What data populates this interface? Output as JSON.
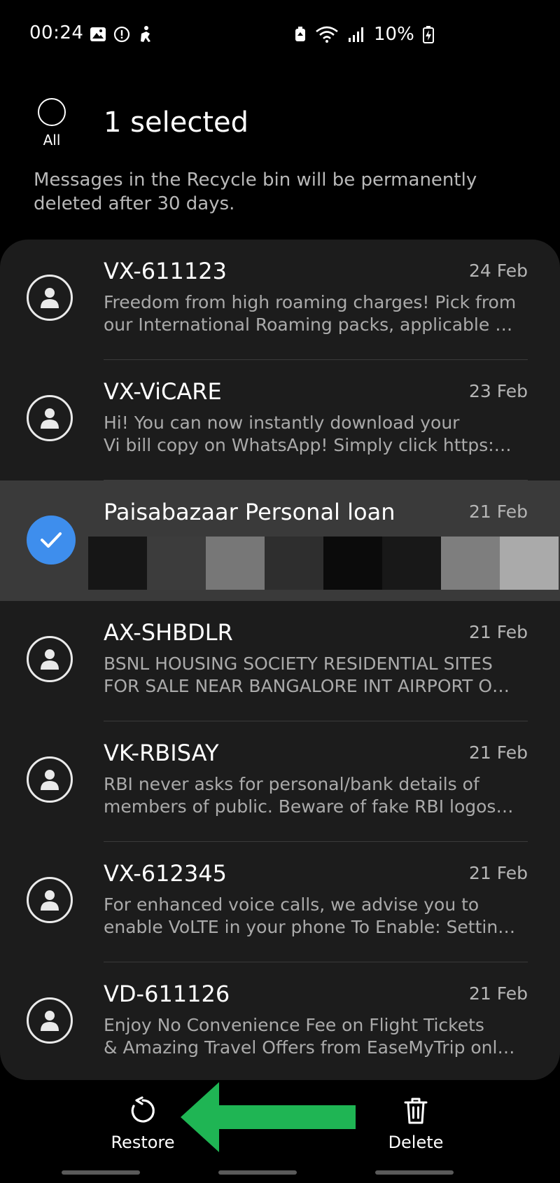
{
  "status_bar": {
    "time": "00:24",
    "battery": "10%",
    "icons_left": [
      "image-icon",
      "alert-icon",
      "accessibility-icon"
    ],
    "icons_right": [
      "battery-saver-icon",
      "wifi-icon",
      "signal-icon",
      "battery-charging-icon"
    ]
  },
  "header": {
    "select_all_label": "All",
    "title": "1 selected"
  },
  "notice": "Messages in the Recycle bin will be permanently deleted after 30 days.",
  "messages": [
    {
      "sender": "VX-611123",
      "date": "24 Feb",
      "line1": "Freedom from high roaming charges! Pick from",
      "line2": "our International Roaming packs, applicable in...",
      "selected": false
    },
    {
      "sender": "VX-ViCARE",
      "date": "23 Feb",
      "line1": "Hi! You can now instantly download your",
      "line2": "Vi bill copy on WhatsApp! Simply click https://...",
      "selected": false
    },
    {
      "sender": "Paisabazaar Personal loan",
      "date": "21 Feb",
      "line1": "",
      "line2": "",
      "selected": true
    },
    {
      "sender": "AX-SHBDLR",
      "date": "21 Feb",
      "line1": "BSNL HOUSING SOCIETY RESIDENTIAL SITES",
      "line2": "FOR SALE NEAR BANGALORE INT AIRPORT ON...",
      "selected": false
    },
    {
      "sender": "VK-RBISAY",
      "date": "21 Feb",
      "line1": "RBI never asks for personal/bank details of",
      "line2": "members of public. Beware of fake RBI logos a...",
      "selected": false
    },
    {
      "sender": "VX-612345",
      "date": "21 Feb",
      "line1": "For enhanced voice calls, we advise you to",
      "line2": "enable VoLTE in your phone To Enable: Setting...",
      "selected": false
    },
    {
      "sender": "VD-611126",
      "date": "21 Feb",
      "line1": "Enjoy No Convenience Fee on Flight Tickets",
      "line2": "& Amazing Travel Offers from EaseMyTrip only...",
      "selected": false
    }
  ],
  "actions": {
    "restore_label": "Restore",
    "delete_label": "Delete"
  },
  "colors": {
    "accent_blue": "#3e8eed",
    "annotation_arrow": "#1fb554",
    "card_bg": "#1c1c1c",
    "selected_row_bg": "#3a3a3a"
  }
}
